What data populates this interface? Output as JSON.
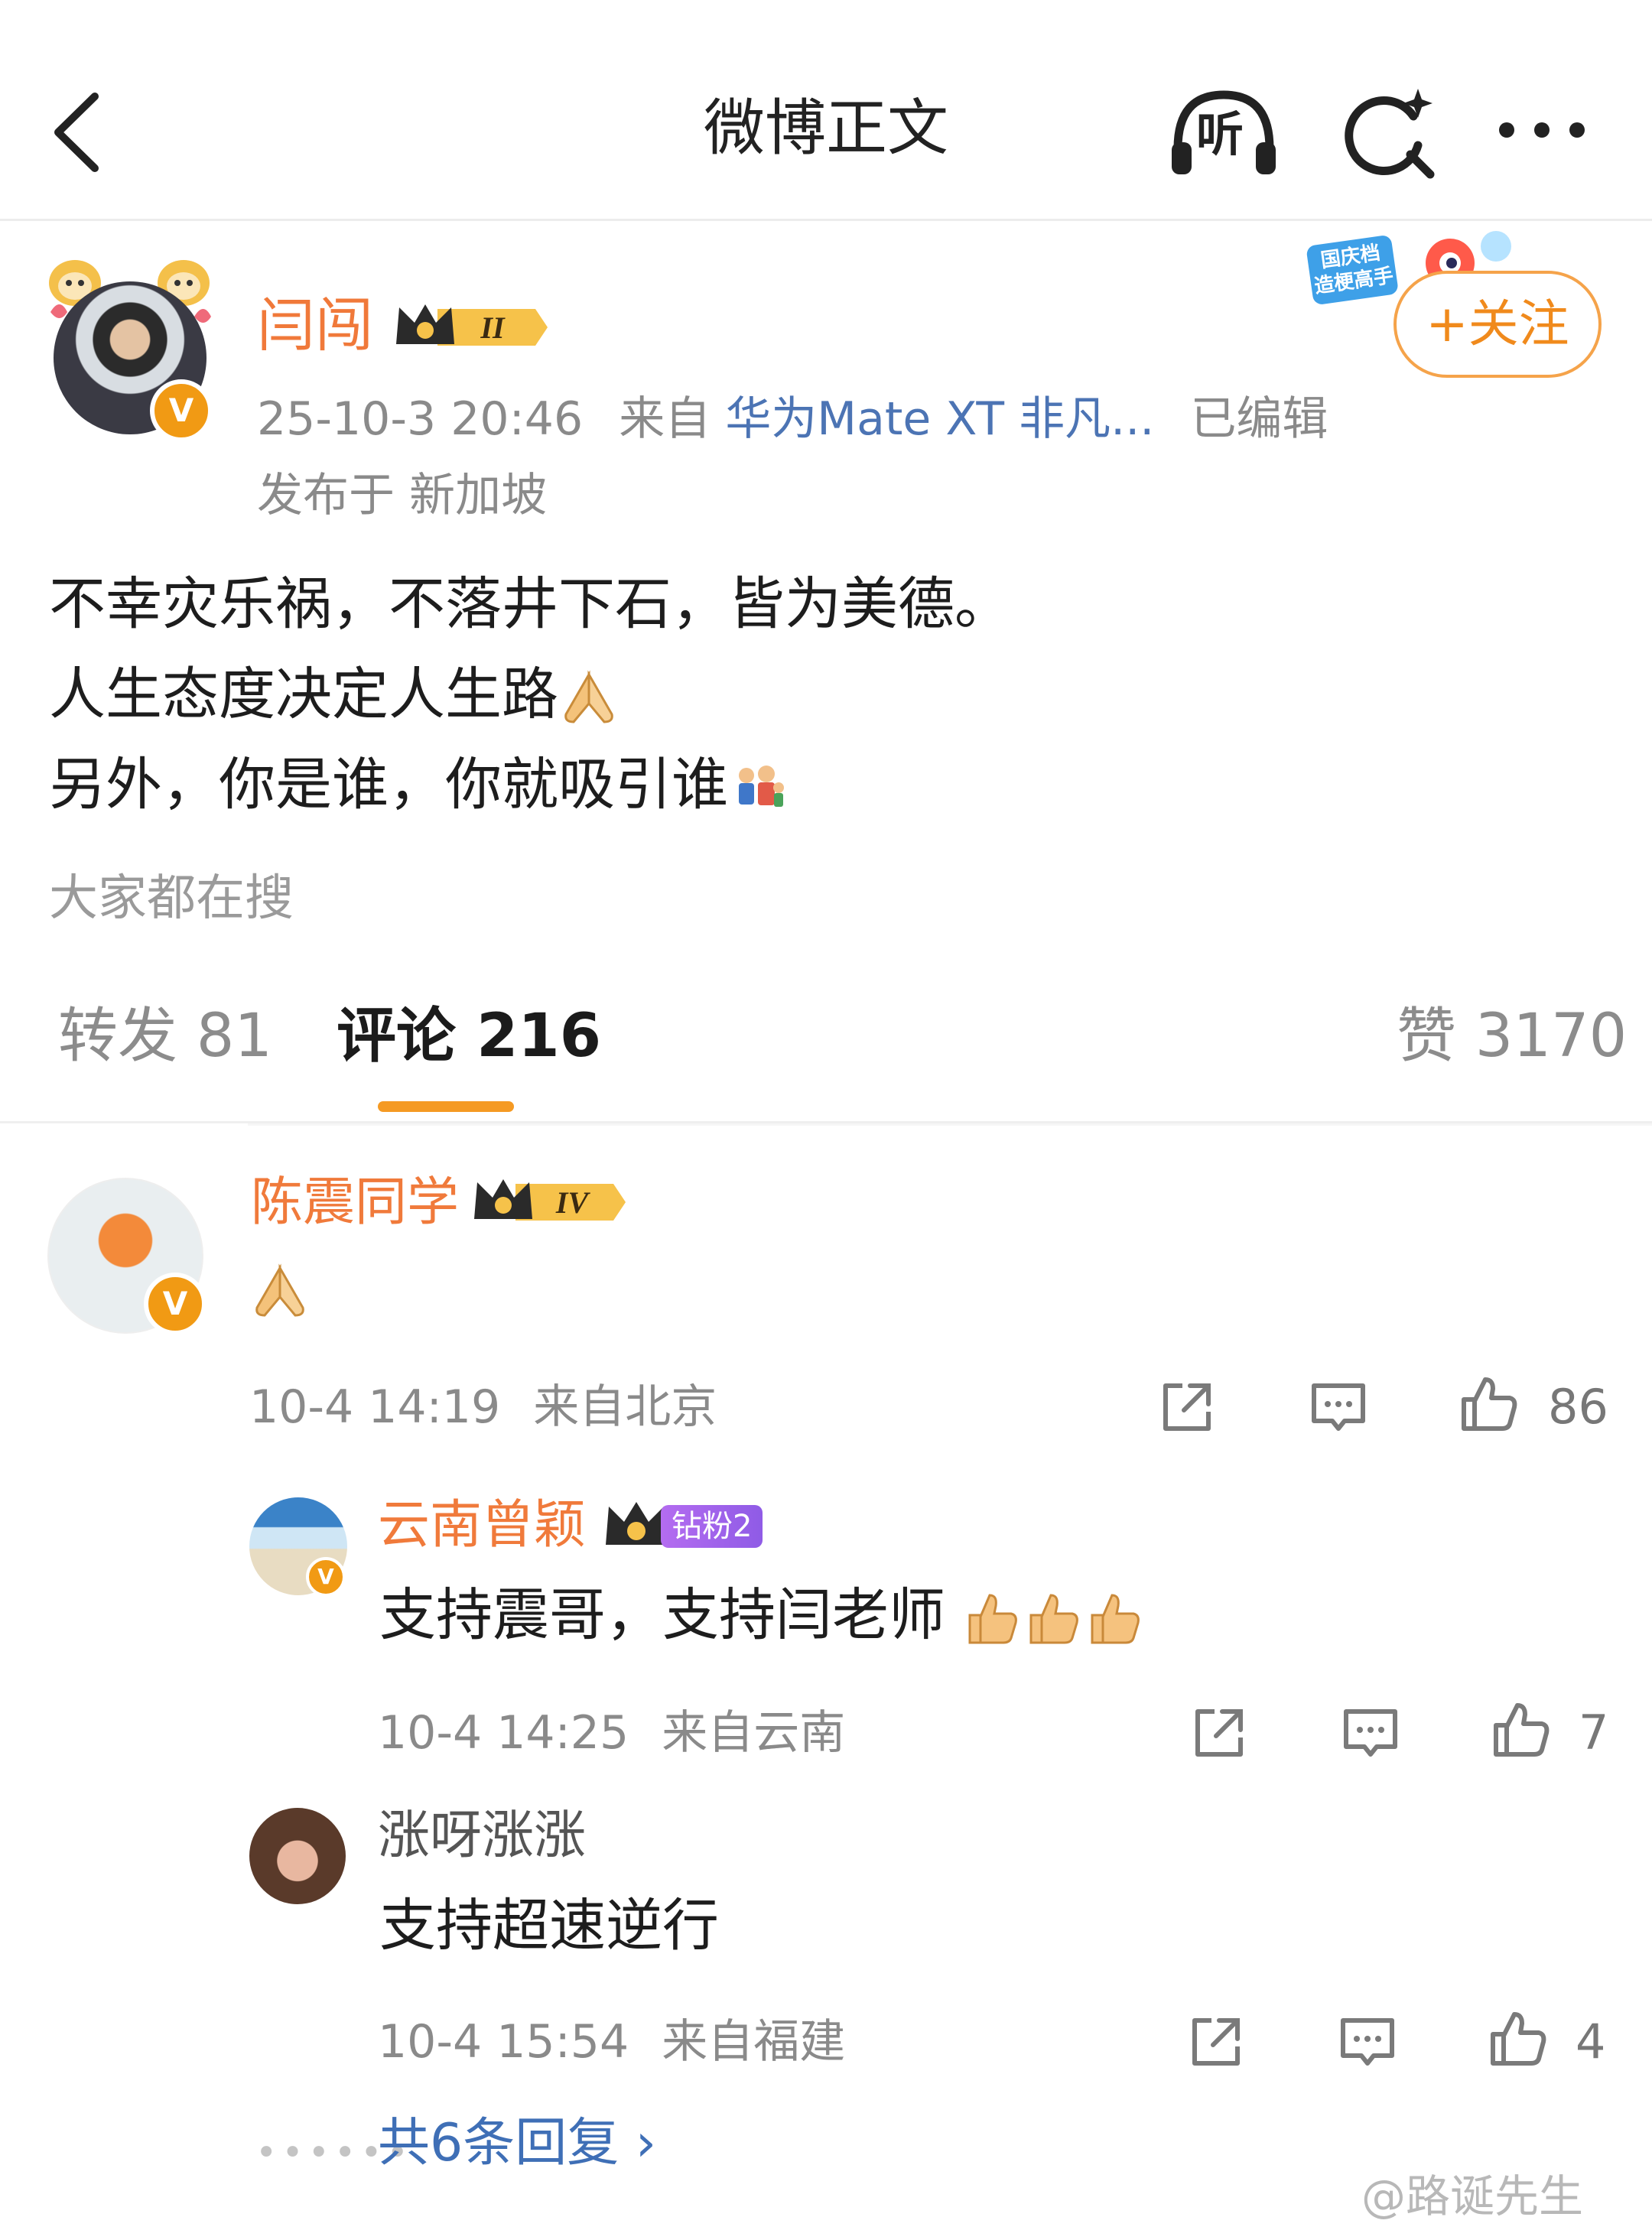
{
  "nav": {
    "title": "微博正文",
    "listen_label": "听"
  },
  "post": {
    "author": {
      "name": "闫闯",
      "level": "II"
    },
    "timestamp": "25-10-3 20:46",
    "from_label": "来自",
    "source": "华为Mate XT 非凡...",
    "edited": "已编辑",
    "location": "发布于 新加坡",
    "follow_label": "+关注",
    "festival_badge": "国庆档 造梗高手",
    "lines": [
      "不幸灾乐祸，不落井下石，皆为美德。",
      "人生态度决定人生路",
      "另外，你是谁，你就吸引谁"
    ],
    "search_hint": "大家都在搜"
  },
  "tabs": {
    "repost": "转发 81",
    "comment": "评论 216",
    "like": "赞 3170"
  },
  "comments": [
    {
      "name": "陈震同学",
      "level": "IV",
      "time": "10-4 14:19",
      "location": "来自北京",
      "likes": "86"
    }
  ],
  "replies": [
    {
      "name": "云南曾颖",
      "fan_badge": "钻粉2",
      "text": "支持震哥，支持闫老师",
      "time": "10-4 14:25",
      "location": "来自云南",
      "likes": "7"
    },
    {
      "name": "涨呀涨涨",
      "text": "支持超速逆行",
      "time": "10-4 15:54",
      "location": "来自福建",
      "likes": "4"
    }
  ],
  "more_replies": "共6条回复 ›",
  "watermark": "@路诞先生",
  "colors": {
    "accent_orange": "#f0793a",
    "tab_underline": "#f59a23",
    "link_blue": "#3f6fb6",
    "verified": "#f19a14"
  },
  "icons": [
    "back-icon",
    "headphones-icon",
    "search-icon",
    "more-icon",
    "share-icon",
    "comment-icon",
    "like-icon",
    "folded-hands-icon",
    "family-icon",
    "thumbs-up-icon",
    "verified-icon",
    "crown-icon"
  ]
}
